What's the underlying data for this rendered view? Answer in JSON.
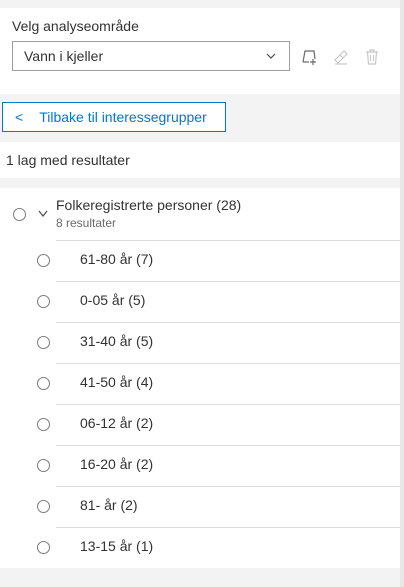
{
  "analysis": {
    "label": "Velg analyseområde",
    "selected": "Vann i kjeller"
  },
  "toolbar": {
    "icons": [
      "draw-area-icon",
      "edit-icon",
      "delete-icon"
    ]
  },
  "back_button": {
    "label": "Tilbake til interessegrupper"
  },
  "summary": {
    "text": "1 lag med resultater"
  },
  "group": {
    "title": "Folkeregistrerte personer (28)",
    "subtitle": "8 resultater"
  },
  "items": [
    {
      "label": "61-80 år (7)"
    },
    {
      "label": "0-05 år (5)"
    },
    {
      "label": "31-40 år (5)"
    },
    {
      "label": "41-50 år (4)"
    },
    {
      "label": "06-12 år (2)"
    },
    {
      "label": "16-20 år (2)"
    },
    {
      "label": "81- år (2)"
    },
    {
      "label": "13-15 år (1)"
    }
  ],
  "colors": {
    "accent": "#007ac2",
    "text": "#323232",
    "muted": "#6a6a6a",
    "panel_bg": "#f3f3f3"
  }
}
